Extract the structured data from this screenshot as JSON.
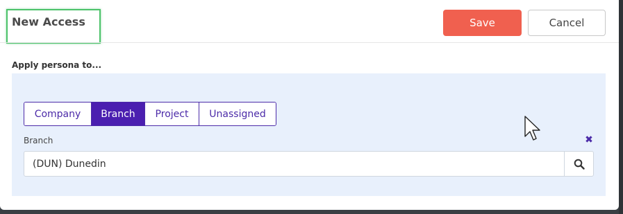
{
  "dialog": {
    "title": "New Access",
    "save_label": "Save",
    "cancel_label": "Cancel"
  },
  "apply": {
    "label": "Apply persona to..."
  },
  "scope_tabs": {
    "options": [
      "Company",
      "Branch",
      "Project",
      "Unassigned"
    ],
    "selected": "Branch"
  },
  "branch_field": {
    "label": "Branch",
    "value": "(DUN) Dunedin"
  },
  "colors": {
    "save": "#f0604f",
    "accent": "#4b1fb0",
    "panel_bg": "#e8f0fc",
    "highlight_border": "#4cc26a"
  }
}
